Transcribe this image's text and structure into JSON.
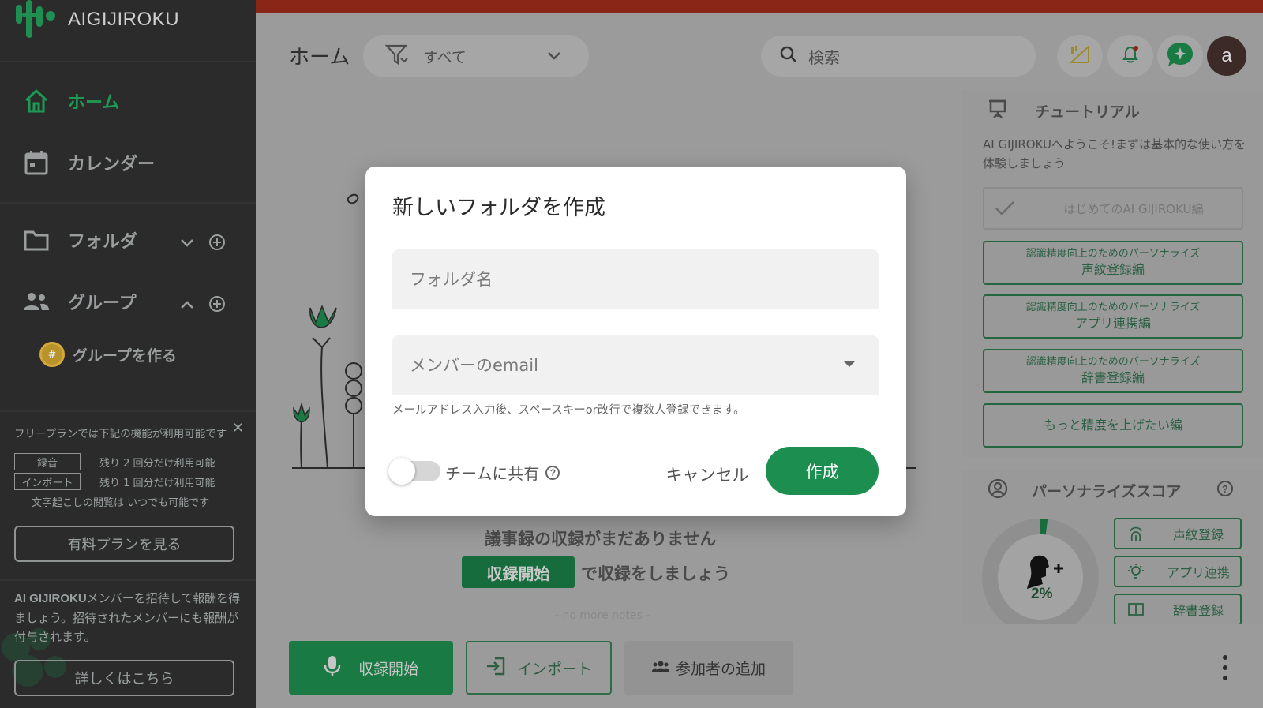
{
  "app": {
    "logo_text": "AIGIJIROKU"
  },
  "sidebar": {
    "items": [
      {
        "label": "ホーム",
        "icon": "home-icon",
        "active": true
      },
      {
        "label": "カレンダー",
        "icon": "calendar-icon"
      },
      {
        "label": "フォルダ",
        "icon": "folder-icon"
      },
      {
        "label": "グループ",
        "icon": "group-icon"
      }
    ],
    "group_make_label": "グループを作る",
    "group_avatar_text": "#",
    "free_plan": {
      "title": "フリープランでは下記の機能が利用可能です",
      "features": [
        {
          "tag": "録音",
          "note": "残り 2 回分だけ利用可能"
        },
        {
          "tag": "インポート",
          "note": "残り 1 回分だけ利用可能"
        }
      ],
      "note": "文字起こしの閲覧は いつでも可能です",
      "paid_button": "有料プランを見る"
    },
    "invite": {
      "brand": "AI GIJIROKU",
      "text": "メンバーを招待して報酬を得ましょう。招待されたメンバーにも報酬が付与されます。",
      "button": "詳しくはこちら"
    }
  },
  "header": {
    "title": "ホーム",
    "filter_label": "すべて",
    "search_placeholder": "検索",
    "avatar_letter": "a"
  },
  "main": {
    "empty_title": "議事録の収録がまだありません",
    "empty_record_label": "収録開始",
    "empty_suffix": "で収録をしましょう",
    "no_more": "- no more notes -"
  },
  "bottom": {
    "record": "収録開始",
    "import": "インポート",
    "participants": "参加者の追加"
  },
  "tutorial": {
    "title": "チュートリアル",
    "desc": "AI GIJIROKUへようこそ!まずは基本的な使い方を体験しましょう",
    "done_item": "はじめてのAI GIJIROKU編",
    "buttons": [
      {
        "small": "認識精度向上のためのパーソナライズ",
        "main": "声紋登録編"
      },
      {
        "small": "認識精度向上のためのパーソナライズ",
        "main": "アプリ連携編"
      },
      {
        "small": "認識精度向上のためのパーソナライズ",
        "main": "辞書登録編"
      },
      {
        "small": "",
        "main": "もっと精度を上げたい編"
      }
    ]
  },
  "score": {
    "title": "パーソナライズスコア",
    "percent": "2%",
    "percent_value": 0.02,
    "buttons": [
      "声紋登録",
      "アプリ連携",
      "辞書登録"
    ]
  },
  "modal": {
    "title": "新しいフォルダを作成",
    "folder_placeholder": "フォルダ名",
    "member_placeholder": "メンバーのemail",
    "hint": "メールアドレス入力後、スペースキーor改行で複数人登録できます。",
    "share_label": "チームに共有",
    "share_enabled": false,
    "cancel": "キャンセル",
    "create": "作成"
  },
  "colors": {
    "accent": "#1c8f50",
    "sidebar_bg": "#2b2b2b",
    "topbar_red": "#8a2618"
  }
}
